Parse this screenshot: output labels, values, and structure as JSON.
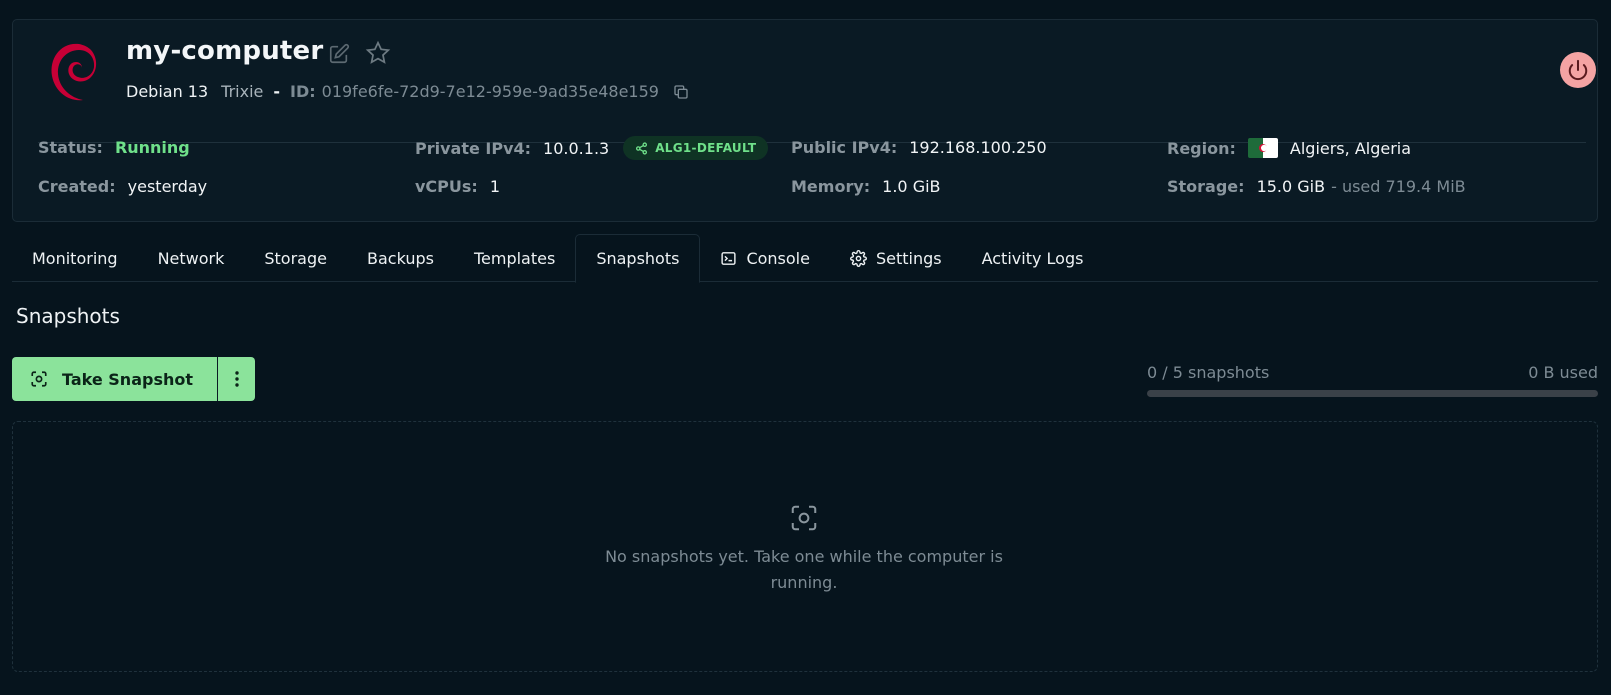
{
  "computer": {
    "name": "my-computer",
    "os_name": "Debian 13",
    "os_codename": "Trixie",
    "separator": "-",
    "id_label": "ID:",
    "id": "019fe6fe-72d9-7e12-959e-9ad35e48e159"
  },
  "details": {
    "status_label": "Status:",
    "status": "Running",
    "created_label": "Created:",
    "created": "yesterday",
    "private_ipv4_label": "Private IPv4:",
    "private_ipv4": "10.0.1.3",
    "network_badge": "ALG1-DEFAULT",
    "vcpus_label": "vCPUs:",
    "vcpus": "1",
    "public_ipv4_label": "Public IPv4:",
    "public_ipv4": "192.168.100.250",
    "memory_label": "Memory:",
    "memory": "1.0 GiB",
    "region_label": "Region:",
    "region": "Algiers, Algeria",
    "storage_label": "Storage:",
    "storage": "15.0 GiB",
    "storage_used": "- used 719.4 MiB"
  },
  "tabs": [
    {
      "label": "Monitoring"
    },
    {
      "label": "Network"
    },
    {
      "label": "Storage"
    },
    {
      "label": "Backups"
    },
    {
      "label": "Templates"
    },
    {
      "label": "Snapshots"
    },
    {
      "label": "Console",
      "icon": "terminal-icon"
    },
    {
      "label": "Settings",
      "icon": "gear-icon"
    },
    {
      "label": "Activity Logs"
    }
  ],
  "active_tab": "Snapshots",
  "snapshots": {
    "title": "Snapshots",
    "take_label": "Take Snapshot",
    "count_text": "0 / 5 snapshots",
    "size_text": "0 B used",
    "usage_fraction": 0,
    "empty_text": "No snapshots yet. Take one while the computer is running."
  },
  "colors": {
    "background": "#06141d",
    "accent_green": "#8be39b",
    "status_running": "#6fe08a",
    "power_button": "#f4a3a3",
    "debian_red": "#c70036"
  }
}
